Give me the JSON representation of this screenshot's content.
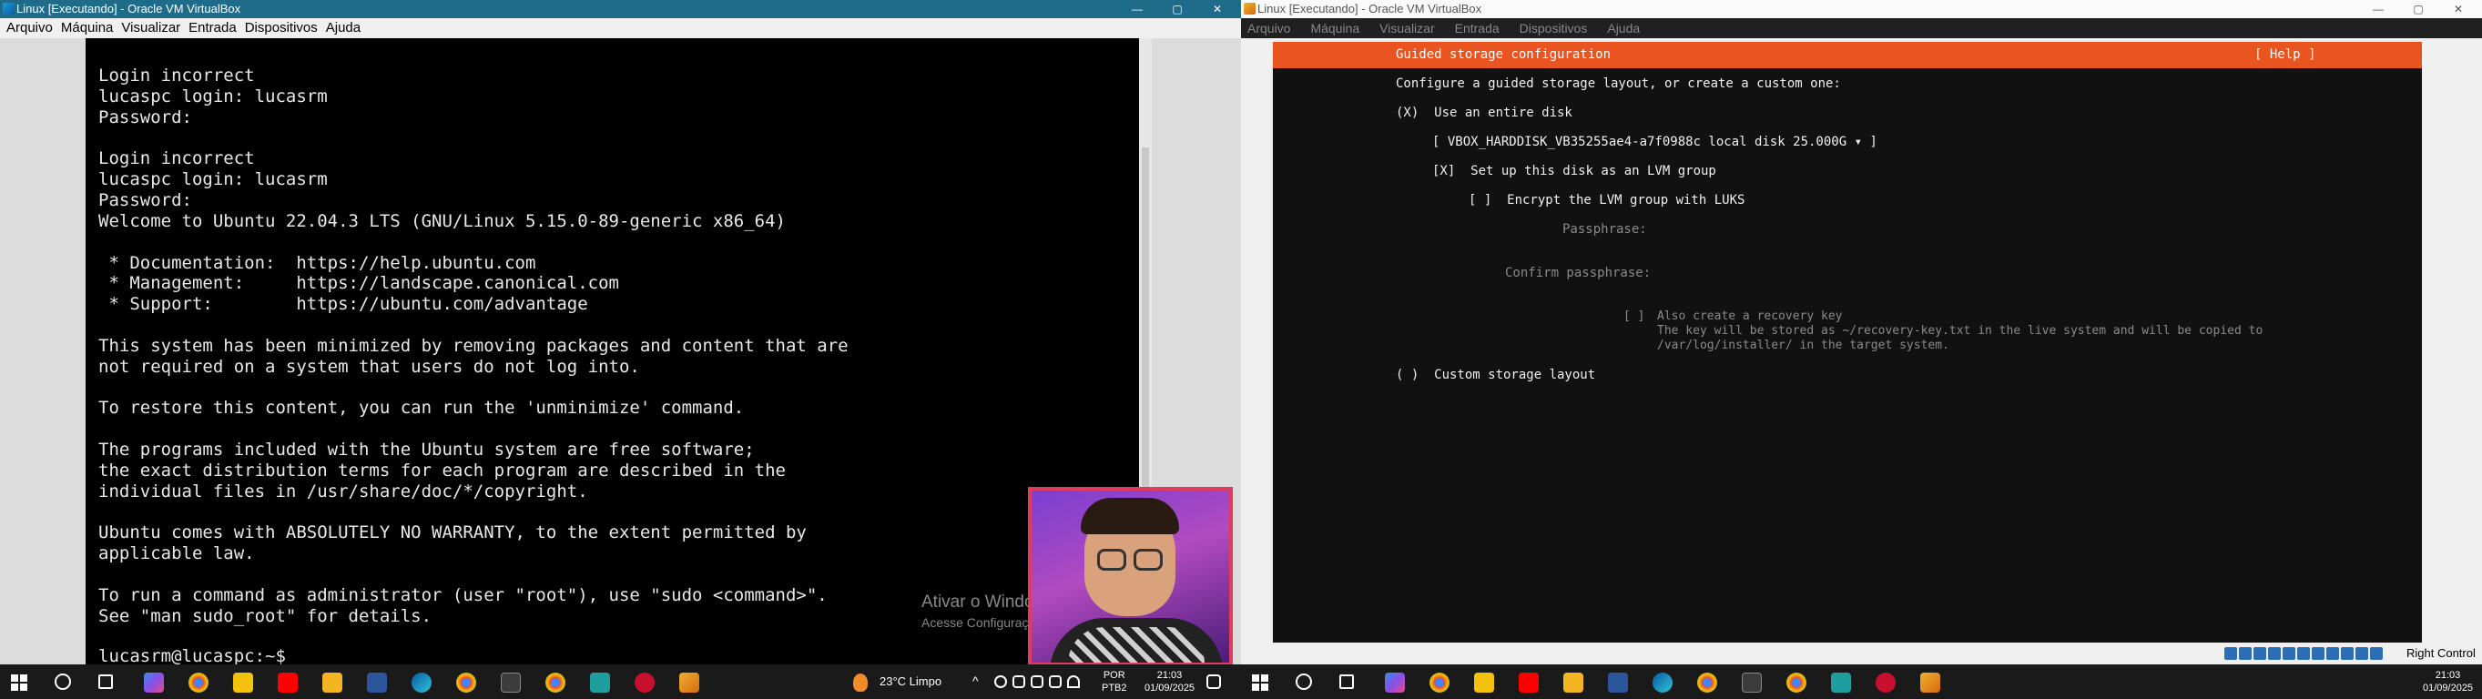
{
  "left": {
    "title": "Linux [Executando] - Oracle VM VirtualBox",
    "window_controls": [
      "—",
      "▢",
      "✕"
    ],
    "menu": [
      "Arquivo",
      "Máquina",
      "Visualizar",
      "Entrada",
      "Dispositivos",
      "Ajuda"
    ],
    "terminal_lines": [
      "Login incorrect",
      "lucaspc login: lucasrm",
      "Password:",
      "",
      "Login incorrect",
      "lucaspc login: lucasrm",
      "Password:",
      "Welcome to Ubuntu 22.04.3 LTS (GNU/Linux 5.15.0-89-generic x86_64)",
      "",
      " * Documentation:  https://help.ubuntu.com",
      " * Management:     https://landscape.canonical.com",
      " * Support:        https://ubuntu.com/advantage",
      "",
      "This system has been minimized by removing packages and content that are",
      "not required on a system that users do not log into.",
      "",
      "To restore this content, you can run the 'unminimize' command.",
      "",
      "The programs included with the Ubuntu system are free software;",
      "the exact distribution terms for each program are described in the",
      "individual files in /usr/share/doc/*/copyright.",
      "",
      "Ubuntu comes with ABSOLUTELY NO WARRANTY, to the extent permitted by",
      "applicable law.",
      "",
      "To run a command as administrator (user \"root\"), use \"sudo <command>\".",
      "See \"man sudo_root\" for details.",
      "",
      "lucasrm@lucaspc:~$"
    ],
    "watermark_title": "Ativar o Windows",
    "watermark_sub": "Acesse Configurações para ativar o Windows.",
    "taskbar": {
      "weather": "23°C  Limpo",
      "lang": "POR",
      "layout": "PTB2",
      "time": "21:03",
      "date": "01/09/2025"
    }
  },
  "right": {
    "title": "Linux [Executando] - Oracle VM VirtualBox",
    "window_controls": [
      "—",
      "▢",
      "✕"
    ],
    "menu": [
      "Arquivo",
      "Máquina",
      "Visualizar",
      "Entrada",
      "Dispositivos",
      "Ajuda"
    ],
    "installer": {
      "header": "Guided storage configuration",
      "help": "[ Help ]",
      "intro": "Configure a guided storage layout, or create a custom one:",
      "use_entire_disk": "(X)  Use an entire disk",
      "disk": "[ VBOX_HARDDISK_VB35255ae4-a7f0988c local disk 25.000G ▾ ]",
      "lvm": "[X]  Set up this disk as an LVM group",
      "encrypt": "[ ]  Encrypt the LVM group with LUKS",
      "passphrase": "Passphrase:",
      "confirm_passphrase": "Confirm passphrase:",
      "recovery_check": "[ ]",
      "recovery_1": "Also create a recovery key",
      "recovery_2": "The key will be stored as ~/recovery-key.txt in the live system and will be copied to",
      "recovery_3": "/var/log/installer/ in the target system.",
      "custom": "( )  Custom storage layout"
    },
    "status_right": "Right Control",
    "taskbar": {
      "time": "21:03",
      "date": "01/09/2025"
    }
  },
  "colors": {
    "ubuntu_orange": "#e95420",
    "vbox_title": "#1f6b8a",
    "taskbar": "#1a1a1a"
  }
}
